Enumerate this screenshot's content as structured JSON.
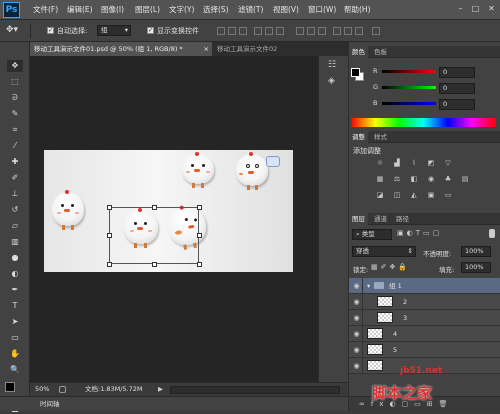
{
  "menubar": {
    "logo": "Ps",
    "items": [
      "文件(F)",
      "编辑(E)",
      "图像(I)",
      "图层(L)",
      "文字(Y)",
      "选择(S)",
      "滤镜(T)",
      "视图(V)",
      "窗口(W)",
      "帮助(H)"
    ],
    "window_buttons": [
      "–",
      "□",
      "✕"
    ]
  },
  "options": {
    "auto_select_label": "自动选择:",
    "auto_select_checked": true,
    "auto_select_value": "组",
    "show_transform_label": "显示变换控件",
    "show_transform_checked": true
  },
  "doc_tabs": [
    {
      "label": "移动工具演示文件01.psd @ 50% (组 1, RGB/8) *",
      "close": "×",
      "active": true
    },
    {
      "label": "移动工具演示文件02",
      "active": false
    }
  ],
  "status": {
    "zoom": "50%",
    "doc": "文档:1.83M/5.72M"
  },
  "timeline": {
    "label": "时间轴"
  },
  "color_panel": {
    "tabs": [
      "颜色",
      "色板"
    ],
    "r": {
      "label": "R",
      "value": "0"
    },
    "g": {
      "label": "G",
      "value": "0"
    },
    "b": {
      "label": "B",
      "value": "0"
    }
  },
  "adjust_panel": {
    "tabs": [
      "调整",
      "样式"
    ],
    "title": "添加调整"
  },
  "layers_panel": {
    "tabs": [
      "图层",
      "通道",
      "路径"
    ],
    "kind_label": "类型",
    "blend_mode": "穿透",
    "opacity_label": "不透明度:",
    "opacity_value": "100%",
    "lock_label": "锁定:",
    "fill_label": "填充:",
    "fill_value": "100%",
    "layers": [
      {
        "name": "组 1",
        "type": "group"
      },
      {
        "name": "2",
        "type": "layer"
      },
      {
        "name": "3",
        "type": "layer"
      },
      {
        "name": "4",
        "type": "layer"
      },
      {
        "name": "5",
        "type": "layer"
      },
      {
        "name": "",
        "type": "layer"
      }
    ]
  },
  "watermark": {
    "url": "jb51.net",
    "text": "脚本之家"
  }
}
